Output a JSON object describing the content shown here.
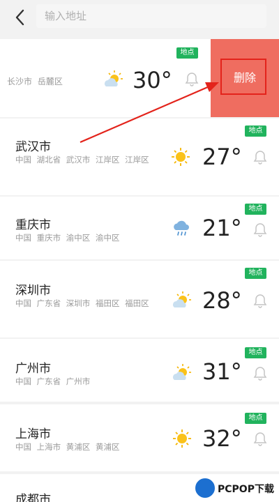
{
  "search": {
    "placeholder": "输入地址"
  },
  "delete_label": "删除",
  "tag_label": "地点",
  "colors": {
    "accent": "#21b35d",
    "delete": "#ef6d60",
    "delete_border": "#e3231b",
    "arrow": "#e3231b"
  },
  "cities": [
    {
      "name": "",
      "region": "长沙市  岳麓区",
      "weather_icon": "partly-cloudy-icon",
      "temp": "30°"
    },
    {
      "name": "武汉市",
      "region": "中国 湖北省 武汉市 江岸区 江岸区",
      "weather_icon": "sunny-icon",
      "temp": "27°"
    },
    {
      "name": "重庆市",
      "region": "中国 重庆市 渝中区 渝中区",
      "weather_icon": "rain-icon",
      "temp": "21°"
    },
    {
      "name": "深圳市",
      "region": "中国 广东省 深圳市 福田区 福田区",
      "weather_icon": "partly-cloudy-icon",
      "temp": "28°"
    },
    {
      "name": "广州市",
      "region": "中国 广东省 广州市",
      "weather_icon": "partly-cloudy-icon",
      "temp": "31°"
    },
    {
      "name": "上海市",
      "region": "中国 上海市 黄浦区 黄浦区",
      "weather_icon": "sunny-icon",
      "temp": "32°"
    },
    {
      "name": "成都市",
      "region": "",
      "weather_icon": "partly-cloudy-icon",
      "temp": ""
    }
  ],
  "watermark": "PCPOP下载"
}
